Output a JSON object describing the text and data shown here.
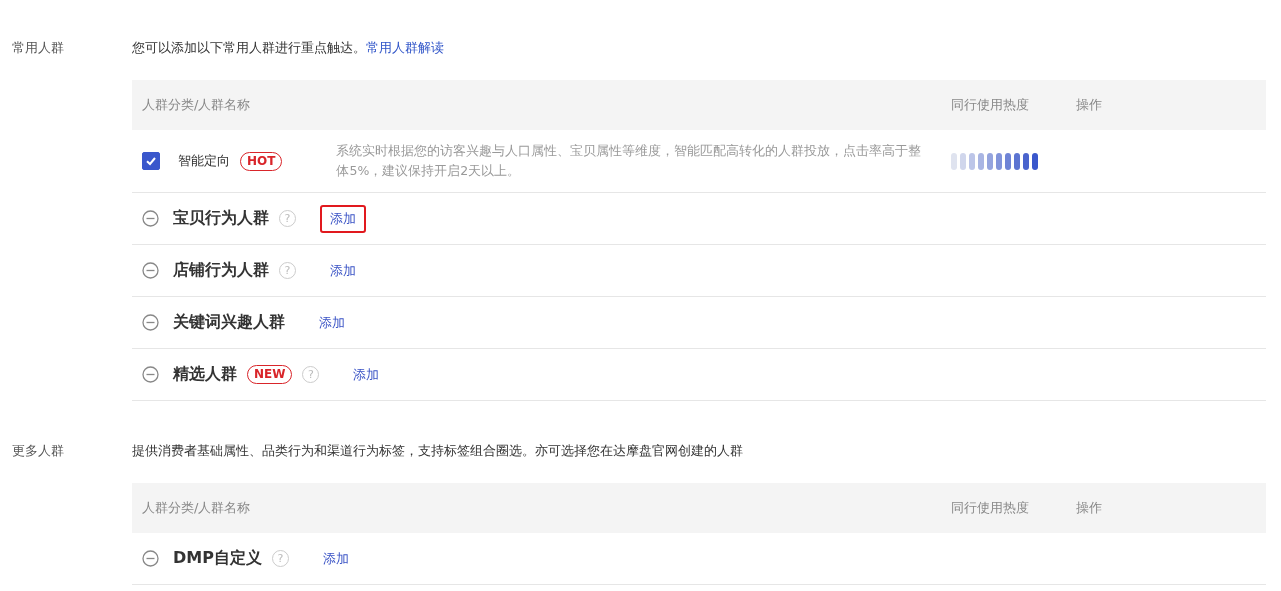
{
  "sections": [
    {
      "label": "常用人群",
      "description": "您可以添加以下常用人群进行重点触达。",
      "link": "常用人群解读",
      "columns": [
        "人群分类/人群名称",
        "同行使用热度",
        "操作"
      ],
      "rows": [
        {
          "kind": "option",
          "checked": true,
          "name": "智能定向",
          "badge": "HOT",
          "description": "系统实时根据您的访客兴趣与人口属性、宝贝属性等维度，智能匹配高转化的人群投放，点击率高于整体5%，建议保持开启2天以上。"
        },
        {
          "kind": "group",
          "name": "宝贝行为人群",
          "help": "?",
          "action": "添加",
          "highlighted": true
        },
        {
          "kind": "group",
          "name": "店铺行为人群",
          "help": "?",
          "action": "添加",
          "highlighted": false
        },
        {
          "kind": "group",
          "name": "关键词兴趣人群",
          "action": "添加",
          "highlighted": false
        },
        {
          "kind": "group",
          "name": "精选人群",
          "badge": "NEW",
          "help": "?",
          "action": "添加",
          "highlighted": false
        }
      ]
    },
    {
      "label": "更多人群",
      "description": "提供消费者基础属性、品类行为和渠道行为标签，支持标签组合圈选。亦可选择您在达摩盘官网创建的人群",
      "columns": [
        "人群分类/人群名称",
        "同行使用热度",
        "操作"
      ],
      "rows": [
        {
          "kind": "group",
          "name": "DMP自定义",
          "help": "?",
          "action": "添加",
          "highlighted": false
        }
      ]
    }
  ]
}
